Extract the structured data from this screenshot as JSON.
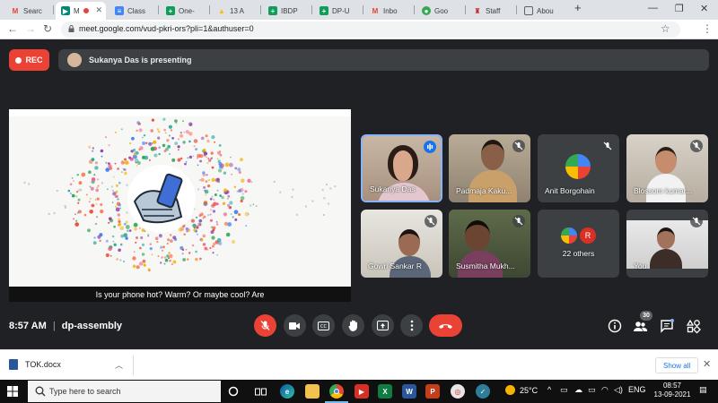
{
  "browser": {
    "tabs": [
      {
        "label": "Searc",
        "icon": "gmail-icon",
        "color": "#ea4335"
      },
      {
        "label": "M",
        "icon": "meet-icon",
        "color": "#00897b",
        "active": true
      },
      {
        "label": "Class",
        "icon": "docs-icon",
        "color": "#4285f4"
      },
      {
        "label": "One-",
        "icon": "sheets-icon",
        "color": "#0f9d58"
      },
      {
        "label": "13 A",
        "icon": "drive-icon",
        "color": "#fbbc04"
      },
      {
        "label": "IBDP",
        "icon": "sheets-icon",
        "color": "#0f9d58"
      },
      {
        "label": "DP-U",
        "icon": "sheets-icon",
        "color": "#0f9d58"
      },
      {
        "label": "Inbo",
        "icon": "gmail-icon",
        "color": "#ea4335"
      },
      {
        "label": "Goo",
        "icon": "google-icon",
        "color": "#34a853"
      },
      {
        "label": "Staff",
        "icon": "site-icon",
        "color": "#c5221f"
      },
      {
        "label": "Abou",
        "icon": "page-icon",
        "color": "#5f6368"
      }
    ],
    "new_tab": "+",
    "url": "meet.google.com/vud-pkri-ors?pli=1&authuser=0",
    "profile_initial": "V"
  },
  "meet": {
    "rec_label": "REC",
    "presenting_text": "Sukanya Das is presenting",
    "caption": "Is your phone hot? Warm? Or maybe cool? Are",
    "participants": [
      {
        "name": "Sukanya Das",
        "speaking": true
      },
      {
        "name": "Padmaja Kaku...",
        "speaking": false
      },
      {
        "name": "Anit Borgohain",
        "speaking": false
      },
      {
        "name": "Blossom kumar...",
        "speaking": false
      },
      {
        "name": "Gowri Sankar R",
        "speaking": false
      },
      {
        "name": "Susmitha Mukh...",
        "speaking": false
      },
      {
        "name": "22 others",
        "speaking": false,
        "initial": "R"
      },
      {
        "name": "You",
        "speaking": false
      }
    ],
    "time": "8:57 AM",
    "separator": "|",
    "meeting_code": "dp-assembly",
    "people_count": "30"
  },
  "downloads": {
    "file": "TOK.docx",
    "show_all": "Show all"
  },
  "taskbar": {
    "search_placeholder": "Type here to search",
    "temperature": "25°C",
    "language": "ENG",
    "time": "08:57",
    "date": "13-09-2021"
  }
}
